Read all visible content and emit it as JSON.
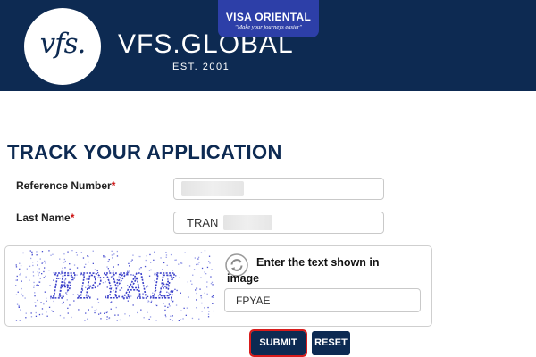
{
  "header": {
    "logo_mark": "vfs.",
    "brand_name": "VFS.GLOBAL",
    "brand_est": "EST. 2001",
    "badge_title": "VISA ORIENTAL",
    "badge_tagline": "\"Make your journeys easier\"",
    "colors": {
      "header_bg": "#0d2a52",
      "badge_bg": "#2d3fa8"
    }
  },
  "page_title": "TRACK YOUR APPLICATION",
  "form": {
    "reference_number": {
      "label": "Reference Number",
      "required_mark": "*",
      "value": ""
    },
    "last_name": {
      "label": "Last Name",
      "required_mark": "*",
      "value": "TRAN"
    }
  },
  "captcha": {
    "image_text": "FPYAE",
    "refresh_icon": "refresh-icon",
    "prompt": "Enter the text shown in image",
    "input_value": "FPYAE"
  },
  "buttons": {
    "submit_label": "SUBMIT",
    "reset_label": "RESET",
    "highlight_color": "#d81b1b"
  }
}
